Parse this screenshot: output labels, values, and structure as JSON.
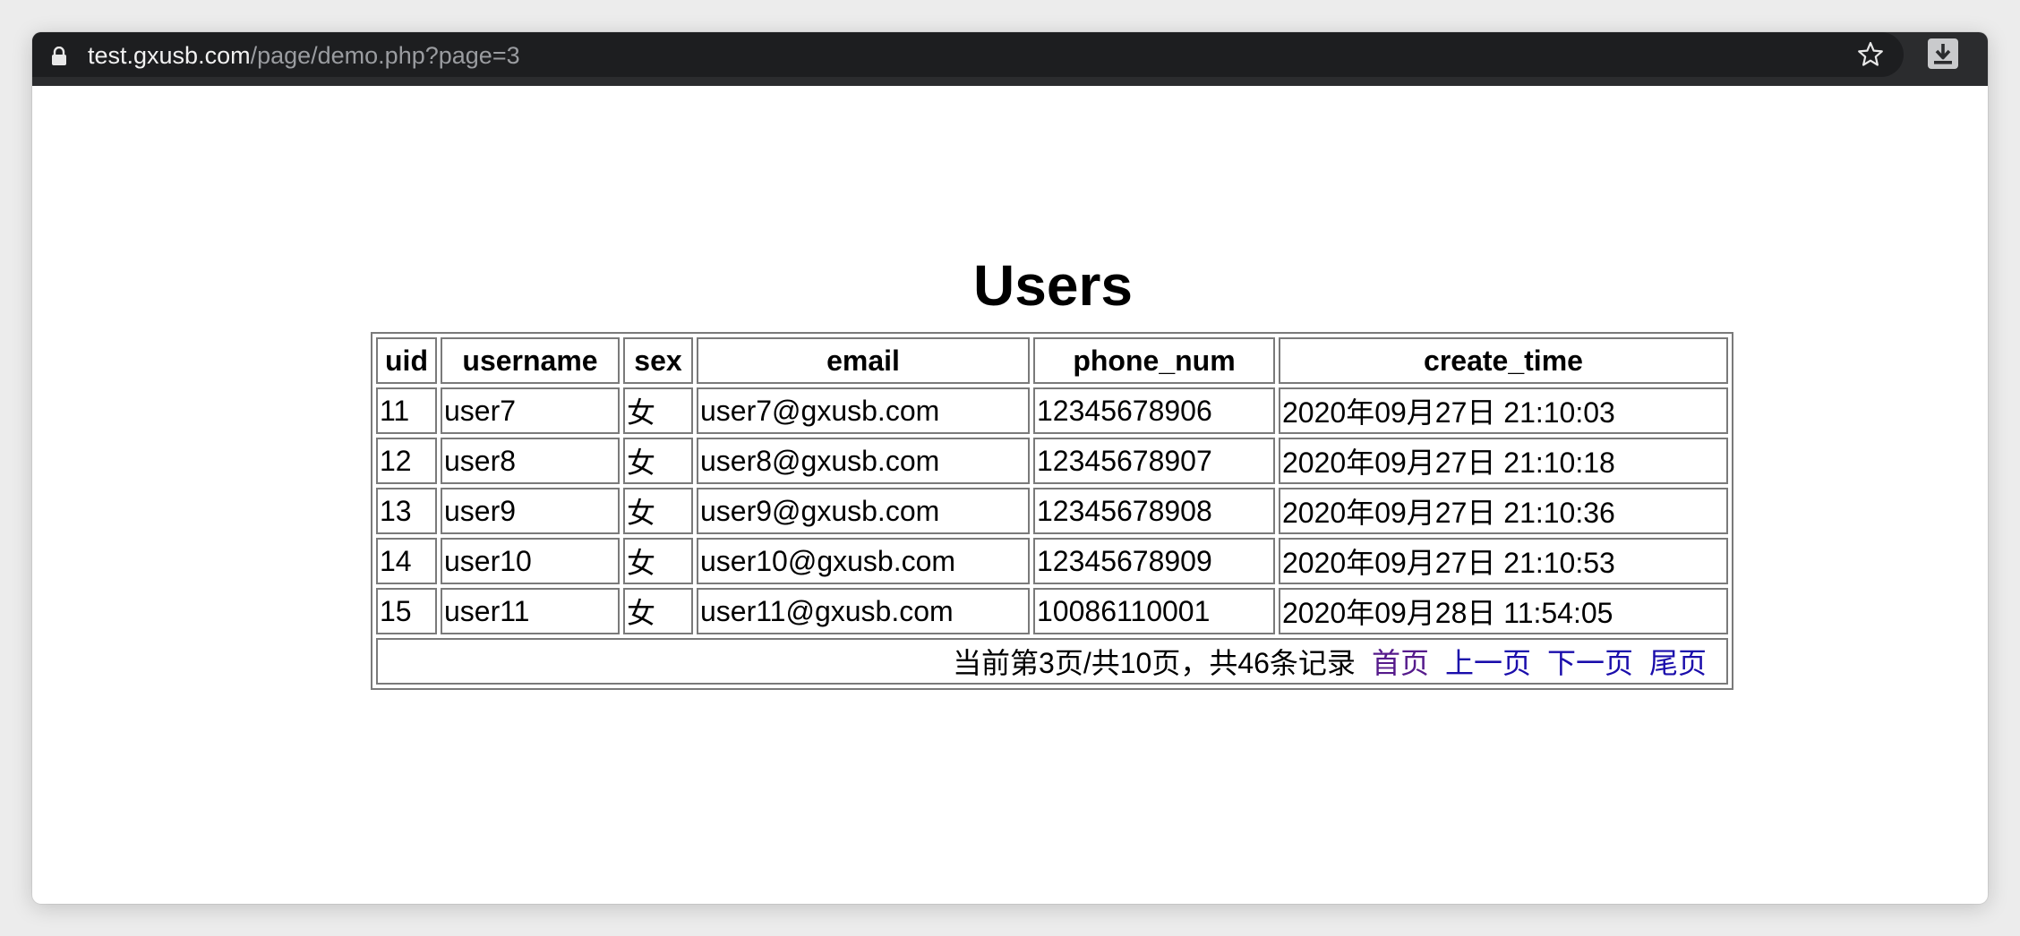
{
  "browser": {
    "url_host": "test.gxusb.com",
    "url_path": "/page/demo.php?page=3"
  },
  "page": {
    "title": "Users"
  },
  "table": {
    "headers": [
      "uid",
      "username",
      "sex",
      "email",
      "phone_num",
      "create_time"
    ],
    "rows": [
      [
        "11",
        "user7",
        "女",
        "user7@gxusb.com",
        "12345678906",
        "2020年09月27日 21:10:03"
      ],
      [
        "12",
        "user8",
        "女",
        "user8@gxusb.com",
        "12345678907",
        "2020年09月27日 21:10:18"
      ],
      [
        "13",
        "user9",
        "女",
        "user9@gxusb.com",
        "12345678908",
        "2020年09月27日 21:10:36"
      ],
      [
        "14",
        "user10",
        "女",
        "user10@gxusb.com",
        "12345678909",
        "2020年09月27日 21:10:53"
      ],
      [
        "15",
        "user11",
        "女",
        "user11@gxusb.com",
        "10086110001",
        "2020年09月28日 11:54:05"
      ]
    ]
  },
  "pager": {
    "summary": "当前第3页/共10页，共46条记录",
    "first": "首页",
    "prev": "上一页",
    "next": "下一页",
    "last": "尾页"
  },
  "colors": {
    "link": "#1a0dab",
    "visited_link": "#551a8b",
    "toolbar": "#2b2c2e"
  }
}
